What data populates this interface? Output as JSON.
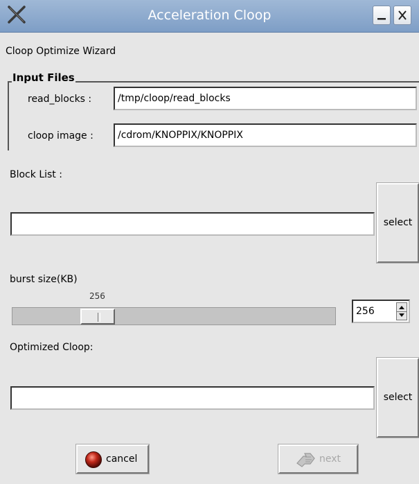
{
  "window": {
    "title": "Acceleration Cloop",
    "icons": {
      "app": "x-logo-icon",
      "minimize": "minimize-icon",
      "close": "close-icon"
    }
  },
  "wizard": {
    "heading": "Cloop Optimize Wizard",
    "input_files": {
      "group_title": "Input Files",
      "read_blocks_label": "read_blocks :",
      "read_blocks_value": "/tmp/cloop/read_blocks",
      "cloop_image_label": "cloop image :",
      "cloop_image_value": "/cdrom/KNOPPIX/KNOPPIX"
    },
    "block_list": {
      "label": "Block List :",
      "value": "",
      "select_label": "select"
    },
    "burst": {
      "label": "burst size(KB)",
      "slider_value": "256",
      "slider_fraction": 0.235,
      "spin_value": "256"
    },
    "optimized": {
      "label": "Optimized Cloop:",
      "value": "",
      "select_label": "select"
    },
    "buttons": {
      "cancel_label": "cancel",
      "cancel_icon": "red-ball-icon",
      "next_label": "next",
      "next_icon": "hand-arrow-icon",
      "next_enabled": false
    }
  }
}
